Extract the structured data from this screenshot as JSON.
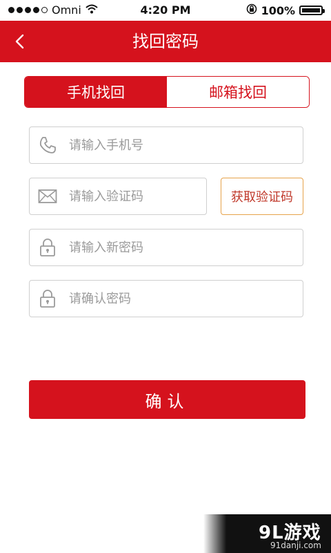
{
  "status_bar": {
    "carrier": "Omni",
    "time": "4:20 PM",
    "battery": "100%",
    "icons": [
      "signal-dots-icon",
      "wifi-icon",
      "rotation-lock-icon",
      "battery-icon"
    ]
  },
  "nav": {
    "title": "找回密码",
    "back_icon": "chevron-left-icon"
  },
  "tabs": [
    {
      "label": "手机找回",
      "active": true
    },
    {
      "label": "邮箱找回",
      "active": false
    }
  ],
  "form": {
    "phone_placeholder": "请输入手机号",
    "code_placeholder": "请输入验证码",
    "get_code_label": "获取验证码",
    "new_password_placeholder": "请输入新密码",
    "confirm_password_placeholder": "请确认密码"
  },
  "confirm_label": "确认",
  "watermark": {
    "logo": "9L游戏",
    "site": "91danji.com"
  },
  "colors": {
    "brand_red": "#d5121d",
    "border_gray": "#cfcfcf",
    "code_button_border": "#e6a24a"
  }
}
